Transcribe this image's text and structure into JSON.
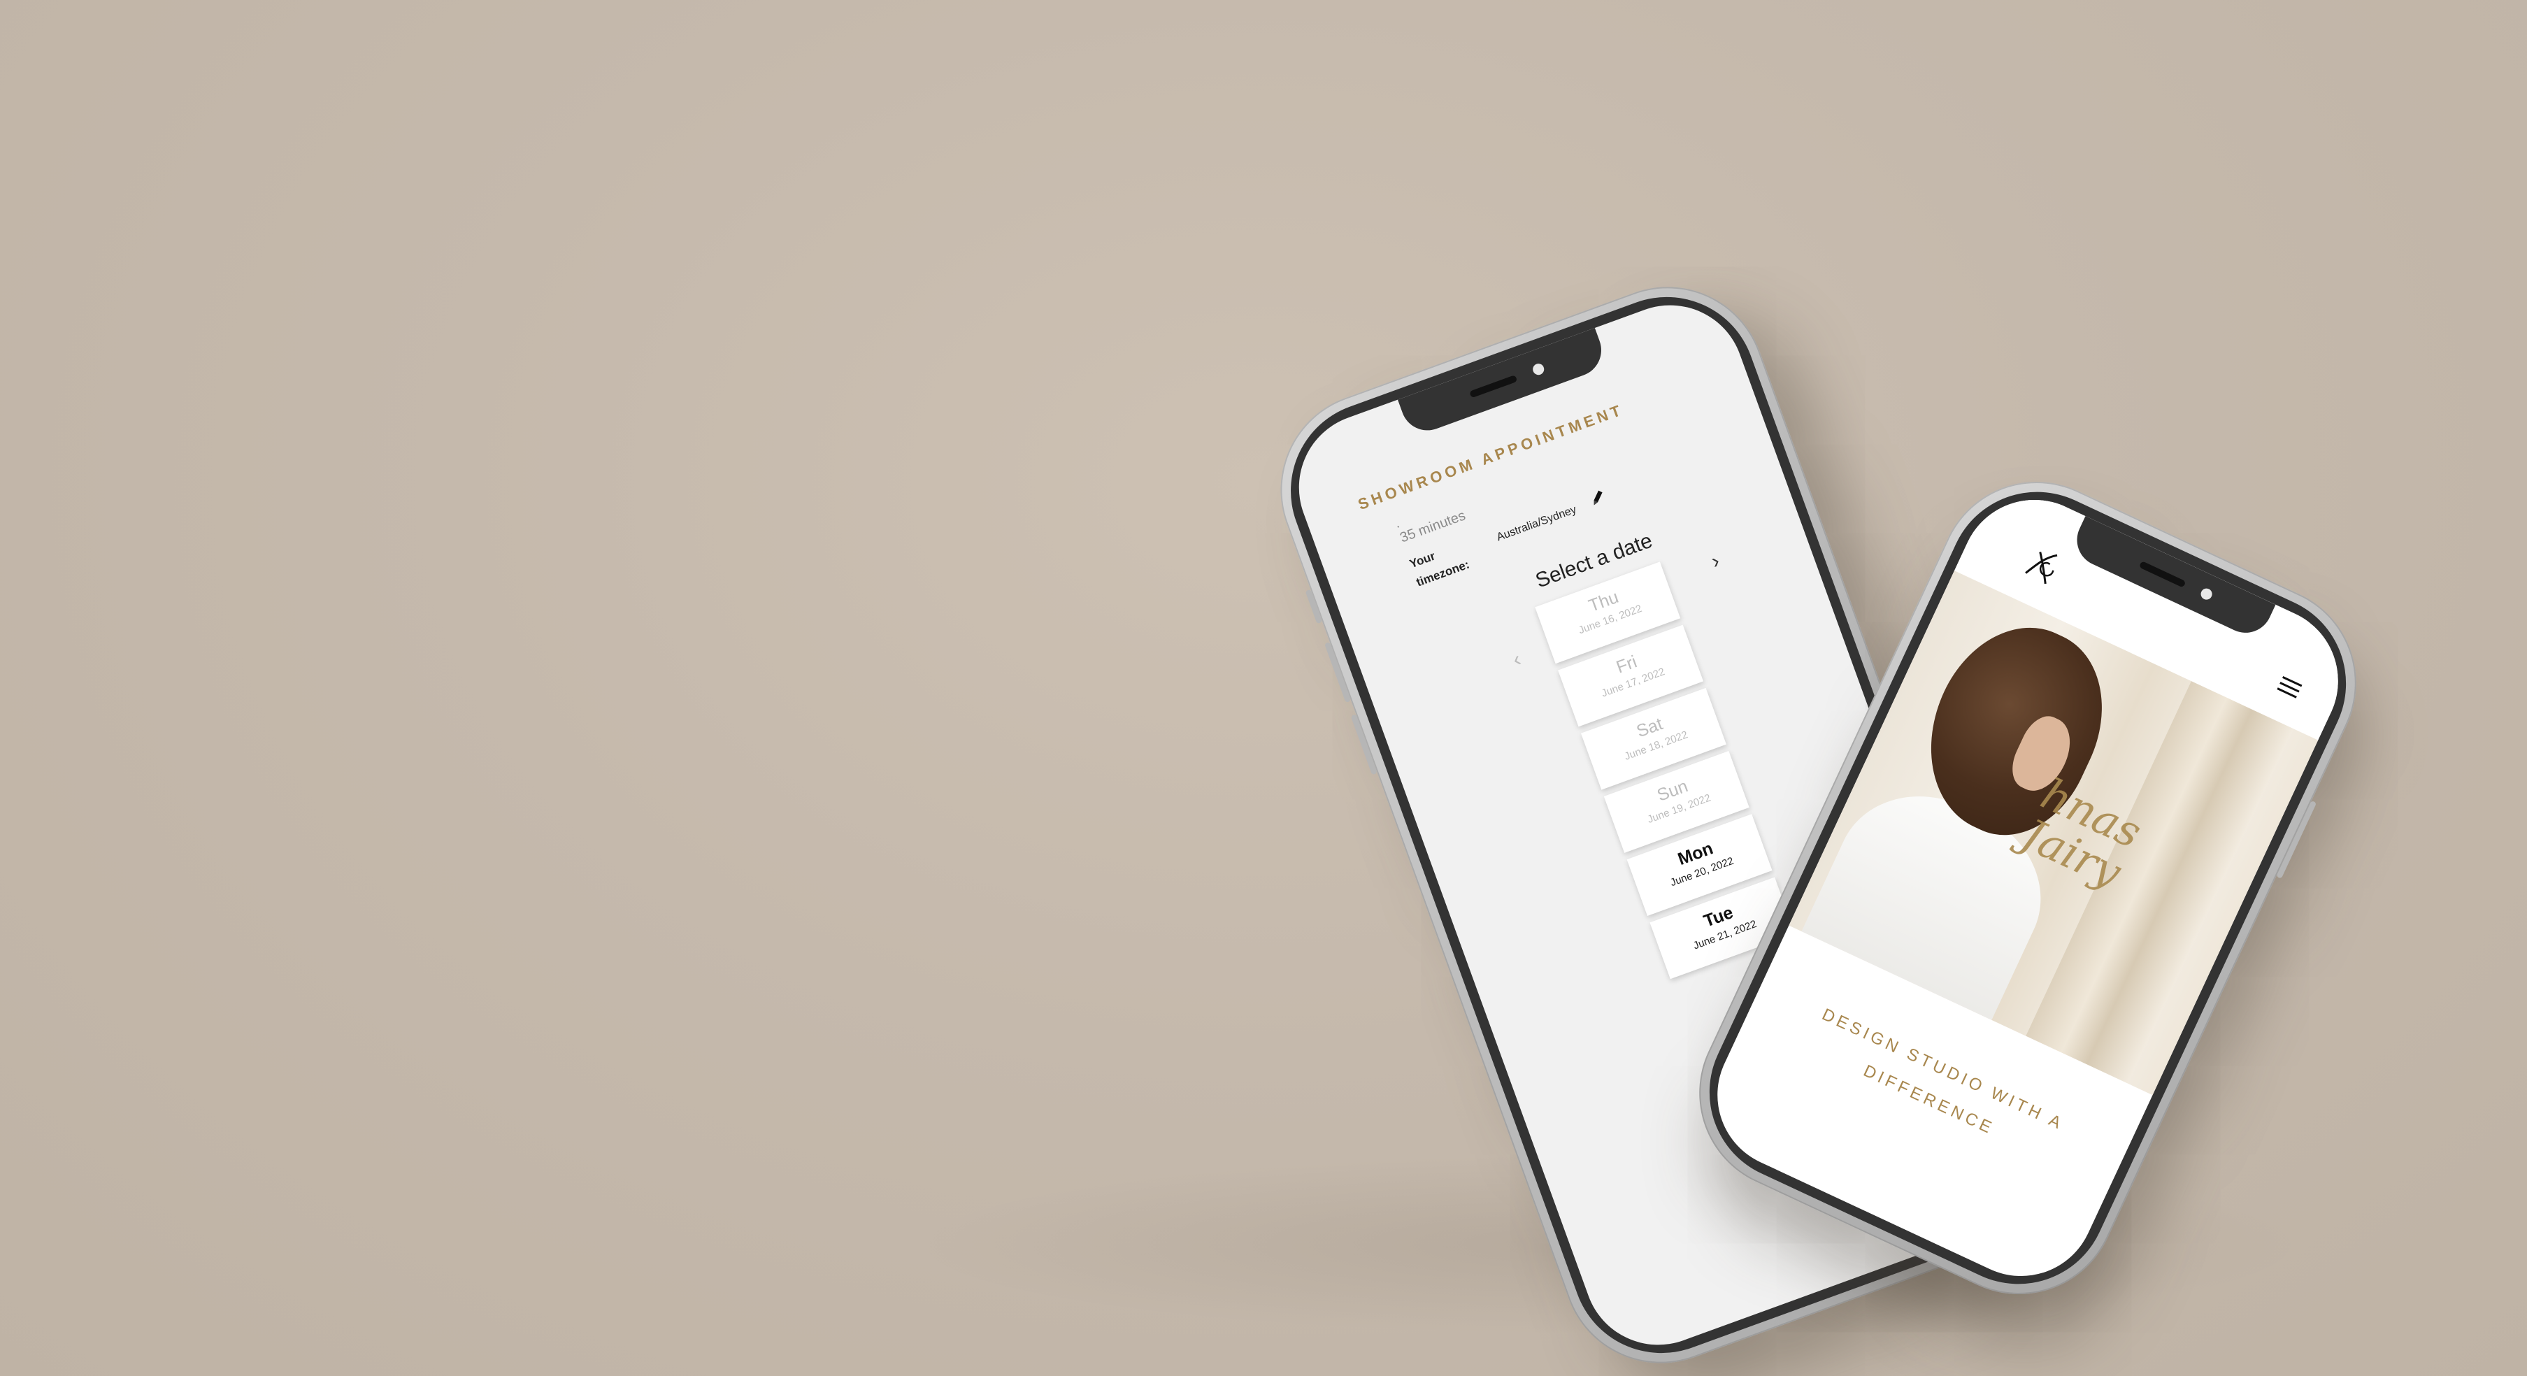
{
  "booking": {
    "title": "SHOWROOM APPOINTMENT",
    "dot": ".",
    "duration": "35 minutes",
    "timezone_label_1": "Your",
    "timezone_label_2": "timezone:",
    "timezone_value": "Australia/Sydney",
    "select_date": "Select a date",
    "prev_arrow": "‹",
    "next_arrow": "›",
    "dates": [
      {
        "day": "Thu",
        "full": "June 16, 2022",
        "available": false
      },
      {
        "day": "Fri",
        "full": "June 17, 2022",
        "available": false
      },
      {
        "day": "Sat",
        "full": "June 18, 2022",
        "available": false
      },
      {
        "day": "Sun",
        "full": "June 19, 2022",
        "available": false
      },
      {
        "day": "Mon",
        "full": "June 20, 2022",
        "available": true
      },
      {
        "day": "Tue",
        "full": "June 21, 2022",
        "available": true
      }
    ],
    "scroll_top_symbol": "^"
  },
  "studio": {
    "script_text_1": "hnas",
    "script_text_2": "Jairy",
    "tagline": "DESIGN STUDIO WITH A DIFFERENCE"
  },
  "colors": {
    "accent_gold": "#a8874e",
    "background": "#c6baad"
  },
  "icons": {
    "edit": "pencil-icon",
    "menu": "hamburger-menu-icon",
    "logo": "monogram-logo"
  }
}
